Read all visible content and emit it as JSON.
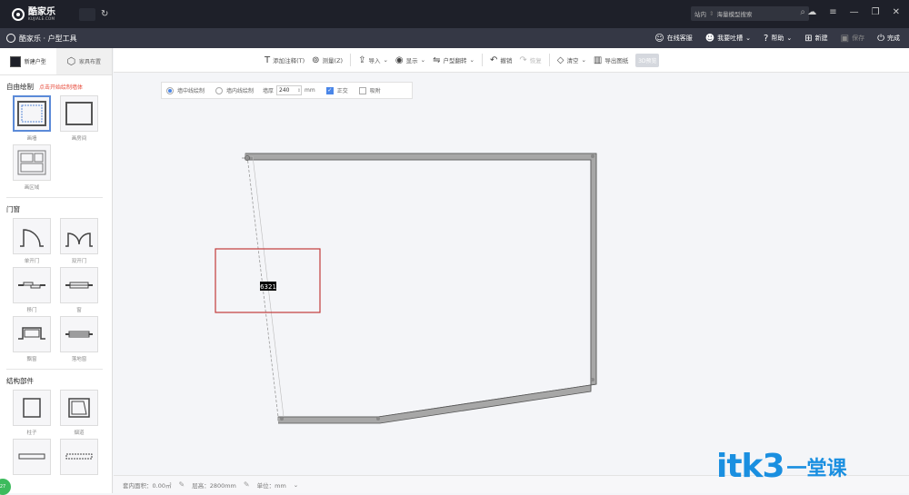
{
  "app": {
    "brand": "酷家乐",
    "brand_en": "KUJIALE.COM",
    "module_title": "酷家乐 · 户型工具"
  },
  "search": {
    "scope": "站内",
    "placeholder": "海量模型搜索"
  },
  "header_actions": [
    {
      "label": "在线客服",
      "icon": "headset-icon"
    },
    {
      "label": "我要吐槽",
      "icon": "face-icon"
    },
    {
      "label": "帮助",
      "icon": "help-icon"
    },
    {
      "label": "新建",
      "icon": "new-file-icon"
    },
    {
      "label": "保存",
      "icon": "save-icon",
      "disabled": true
    },
    {
      "label": "完成",
      "icon": "power-icon"
    }
  ],
  "left_tabs": [
    {
      "label": "新建户型",
      "icon": "floorplan-icon"
    },
    {
      "label": "家具布置",
      "icon": "cube-icon"
    }
  ],
  "free_draw": {
    "title": "自由绘制",
    "hint": "点击开始绘制墙体",
    "items": [
      "画墙",
      "画房间",
      "画区域"
    ]
  },
  "doors_windows": {
    "title": "门窗",
    "items": [
      "单开门",
      "双开门",
      "移门",
      "窗",
      "飘窗",
      "落地窗"
    ]
  },
  "structure": {
    "title": "结构部件",
    "items": [
      "柱子",
      "烟道"
    ]
  },
  "canvas_toolbar": [
    {
      "label": "添加注释(T)",
      "icon": "text-icon"
    },
    {
      "label": "测量(Z)",
      "icon": "ruler-icon"
    },
    {
      "label": "导入",
      "icon": "import-icon"
    },
    {
      "label": "显示",
      "icon": "eye-icon"
    },
    {
      "label": "户型翻转",
      "icon": "flip-icon"
    },
    {
      "label": "撤销",
      "icon": "undo-icon"
    },
    {
      "label": "恢复",
      "icon": "redo-icon"
    },
    {
      "label": "清空",
      "icon": "eraser-icon"
    },
    {
      "label": "导出图纸",
      "icon": "export-icon"
    },
    {
      "label": "3D预览",
      "icon": ""
    }
  ],
  "draw_options": {
    "center_line": "墙中线绘制",
    "inner_line": "墙内线绘制",
    "thickness_label": "墙厚",
    "thickness_value": "240",
    "unit": "mm",
    "ortho_label": "正交",
    "snap_label": "吸附"
  },
  "canvas": {
    "dimension_label": "6321"
  },
  "statusbar": {
    "area": "套内面积：0.00㎡",
    "height": "层高：2800mm",
    "unit": "单位：mm"
  },
  "watermark": {
    "text": "itk3",
    "text2": "一堂课"
  },
  "badge": {
    "text": "27"
  },
  "colors": {
    "topbar": "#1e2029",
    "toolbar": "#353845",
    "wall": "#a7a7a7",
    "selection_box": "#c23b3b",
    "accent": "#4a86e8",
    "watermark": "#1a8fe0"
  }
}
